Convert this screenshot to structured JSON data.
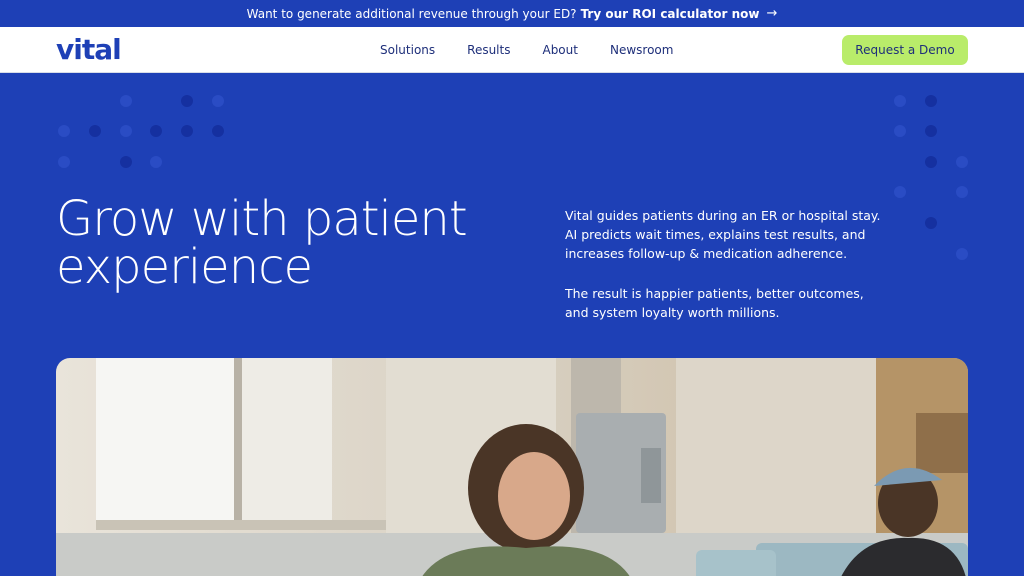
{
  "announcement": {
    "text": "Want to generate additional revenue through your ED?",
    "link": "Try our ROI calculator now",
    "arrow_icon": "arrow-right-icon"
  },
  "nav": {
    "logo": "vital",
    "links": [
      "Solutions",
      "Results",
      "About",
      "Newsroom"
    ],
    "cta": "Request a Demo"
  },
  "hero": {
    "title": "Grow with patient experience",
    "paragraphs": [
      "Vital guides patients during an ER or hospital stay. AI predicts wait times, explains test results, and increases follow-up & medication adherence.",
      "The result is happier patients, better outcomes, and system loyalty worth millions."
    ]
  },
  "colors": {
    "brand_blue": "#1e40b6",
    "cta_green": "#b9ec6a",
    "nav_text": "#1e2f7a"
  }
}
